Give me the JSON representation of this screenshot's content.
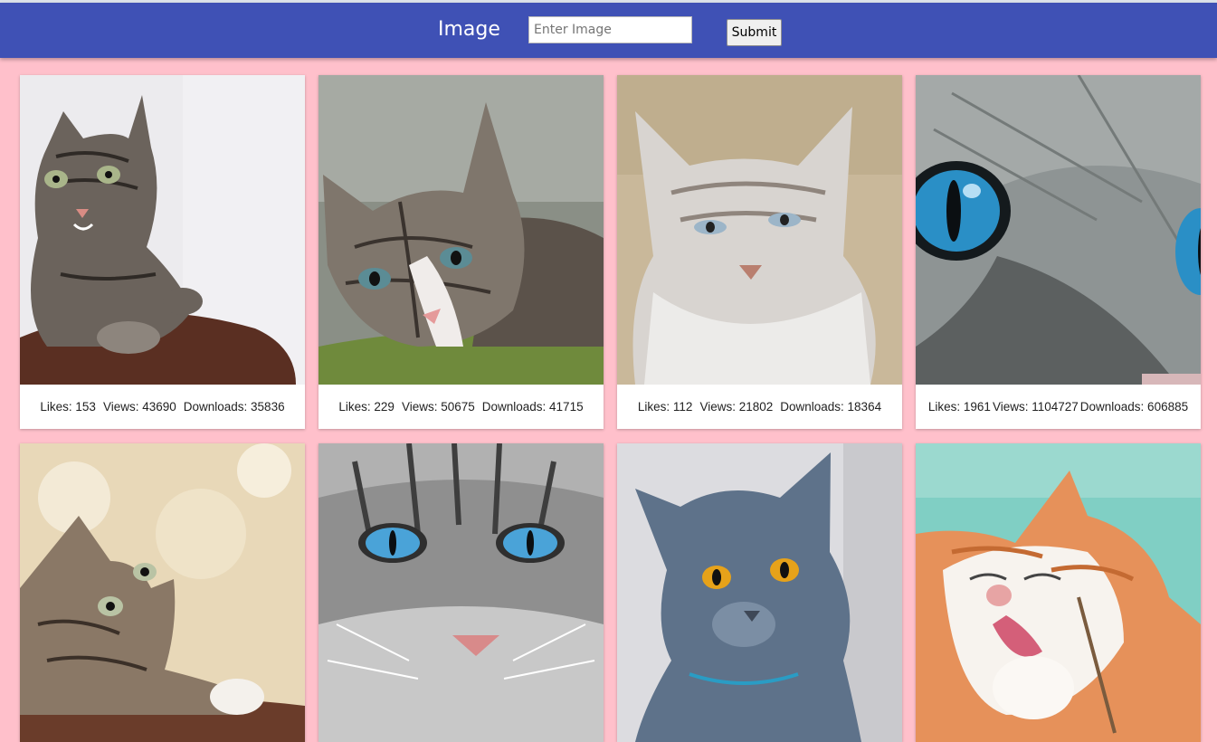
{
  "header": {
    "title": "Image",
    "search_placeholder": "Enter Image",
    "search_value": "",
    "submit_label": "Submit",
    "color": "#3f51b5"
  },
  "page": {
    "background": "#ffc0cb"
  },
  "cards": [
    {
      "image": "tabby-cat-on-cushion",
      "likes": "Likes: 153",
      "views": "Views: 43690",
      "downloads": "Downloads: 35836"
    },
    {
      "image": "tabby-kitten-lying-on-grass",
      "likes": "Likes: 229",
      "views": "Views: 50675",
      "downloads": "Downloads: 41715"
    },
    {
      "image": "grey-white-cat-portrait",
      "likes": "Likes: 112",
      "views": "Views: 21802",
      "downloads": "Downloads: 18364"
    },
    {
      "image": "cat-blue-eyes-closeup",
      "likes": "Likes: 1961",
      "views": "Views: 1104727",
      "downloads": "Downloads: 606885"
    },
    {
      "image": "kitten-looking-up",
      "likes": "",
      "views": "",
      "downloads": ""
    },
    {
      "image": "grey-cat-blue-eyes-face",
      "likes": "",
      "views": "",
      "downloads": ""
    },
    {
      "image": "british-shorthair-blue-cat",
      "likes": "",
      "views": "",
      "downloads": ""
    },
    {
      "image": "orange-white-cat-licking",
      "likes": "",
      "views": "",
      "downloads": ""
    }
  ]
}
